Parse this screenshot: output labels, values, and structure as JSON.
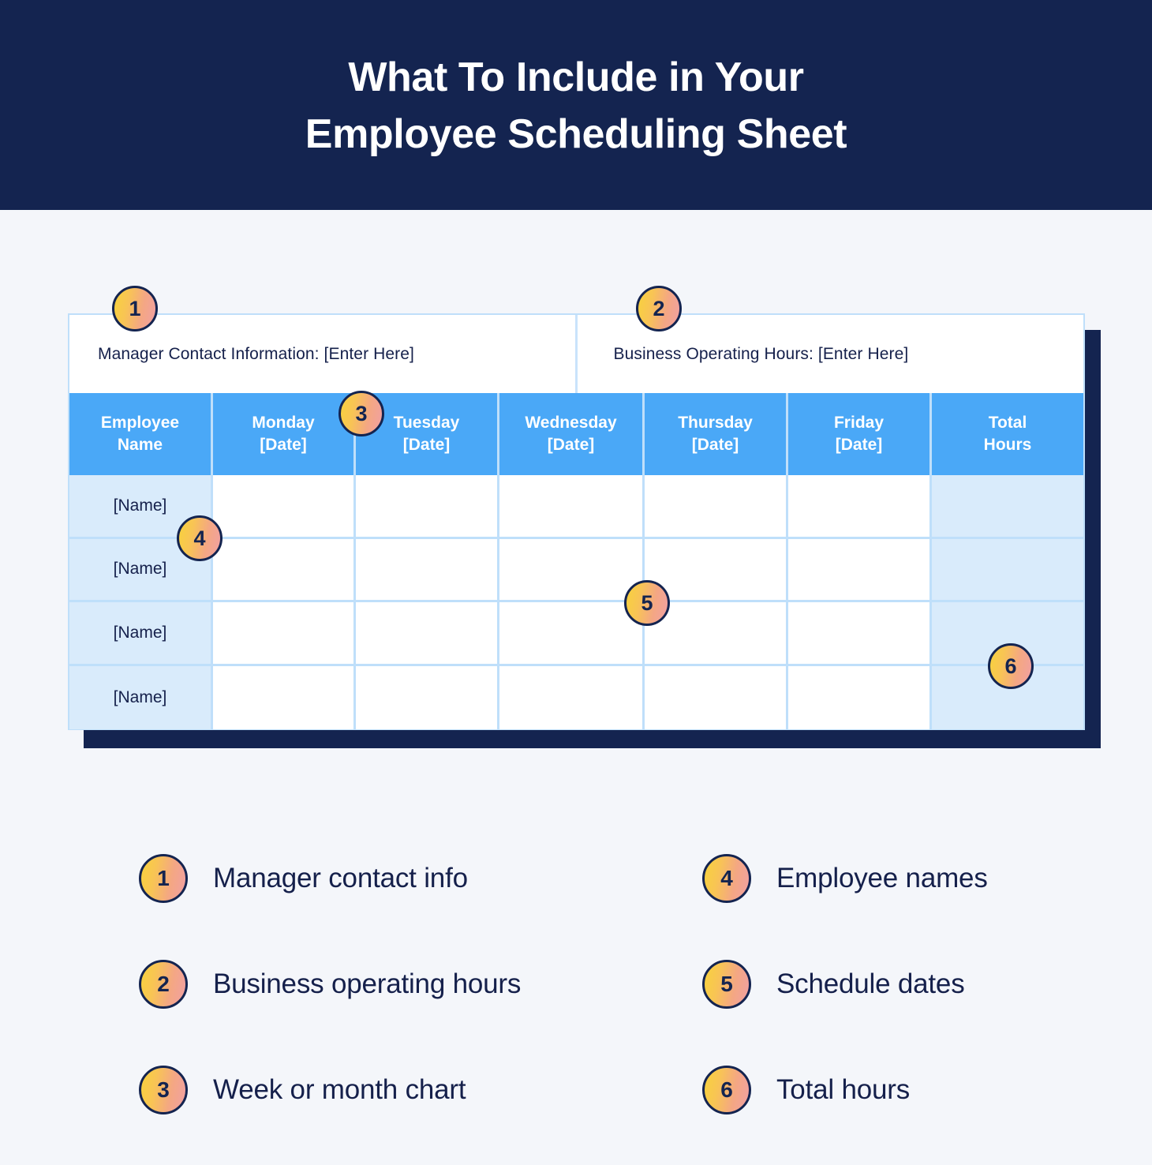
{
  "banner": {
    "title_line1": "What To Include in Your",
    "title_line2": "Employee Scheduling Sheet",
    "background_color": "#142450",
    "text_color": "#FFFFFF"
  },
  "colors": {
    "page_background": "#F4F6FA",
    "navy": "#142450",
    "header_blue": "#4AA8F7",
    "grid_blue": "#BFDFFA",
    "tinted_cell": "#D9EBFB",
    "badge_gradient_start": "#F7D23C",
    "badge_gradient_end": "#F1A0A3"
  },
  "sheet": {
    "info_row": {
      "manager_contact": "Manager Contact Information: [Enter Here]",
      "business_hours": "Business Operating Hours: [Enter Here]"
    },
    "columns": [
      {
        "line1": "Employee",
        "line2": "Name"
      },
      {
        "line1": "Monday",
        "line2": "[Date]"
      },
      {
        "line1": "Tuesday",
        "line2": "[Date]"
      },
      {
        "line1": "Wednesday",
        "line2": "[Date]"
      },
      {
        "line1": "Thursday",
        "line2": "[Date]"
      },
      {
        "line1": "Friday",
        "line2": "[Date]"
      },
      {
        "line1": "Total",
        "line2": "Hours"
      }
    ],
    "rows": [
      {
        "name": "[Name]",
        "monday": "",
        "tuesday": "",
        "wednesday": "",
        "thursday": "",
        "friday": "",
        "total": ""
      },
      {
        "name": "[Name]",
        "monday": "",
        "tuesday": "",
        "wednesday": "",
        "thursday": "",
        "friday": "",
        "total": ""
      },
      {
        "name": "[Name]",
        "monday": "",
        "tuesday": "",
        "wednesday": "",
        "thursday": "",
        "friday": "",
        "total": ""
      },
      {
        "name": "[Name]",
        "monday": "",
        "tuesday": "",
        "wednesday": "",
        "thursday": "",
        "friday": "",
        "total": ""
      }
    ]
  },
  "callouts": [
    {
      "number": "1",
      "target": "manager-contact-cell"
    },
    {
      "number": "2",
      "target": "business-hours-cell"
    },
    {
      "number": "3",
      "target": "day-columns-header"
    },
    {
      "number": "4",
      "target": "employee-name-column"
    },
    {
      "number": "5",
      "target": "schedule-grid"
    },
    {
      "number": "6",
      "target": "total-hours-column"
    }
  ],
  "legend": {
    "left": [
      {
        "number": "1",
        "label": "Manager contact info"
      },
      {
        "number": "2",
        "label": "Business operating hours"
      },
      {
        "number": "3",
        "label": "Week or month chart"
      }
    ],
    "right": [
      {
        "number": "4",
        "label": "Employee names"
      },
      {
        "number": "5",
        "label": "Schedule dates"
      },
      {
        "number": "6",
        "label": "Total hours"
      }
    ]
  }
}
